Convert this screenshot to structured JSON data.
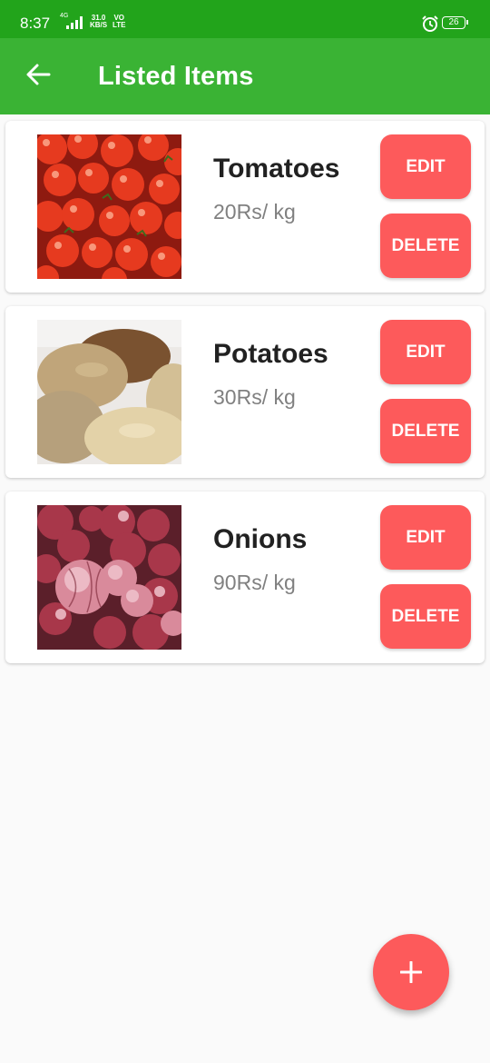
{
  "status_bar": {
    "time": "8:37",
    "network_type": "4G",
    "speed_value": "31.0",
    "speed_unit": "KB/S",
    "volte_top": "VO",
    "volte_bottom": "LTE",
    "battery": "26",
    "icons": [
      "signal-icon",
      "alarm-icon",
      "battery-icon"
    ]
  },
  "toolbar": {
    "back_icon": "arrow-left-icon",
    "title": "Listed Items",
    "background": "#3ab334"
  },
  "items": [
    {
      "name": "Tomatoes",
      "price": "20Rs/ kg",
      "edit_label": "EDIT",
      "delete_label": "DELETE",
      "image": "tomatoes-image"
    },
    {
      "name": "Potatoes",
      "price": "30Rs/ kg",
      "edit_label": "EDIT",
      "delete_label": "DELETE",
      "image": "potatoes-image"
    },
    {
      "name": "Onions",
      "price": "90Rs/ kg",
      "edit_label": "EDIT",
      "delete_label": "DELETE",
      "image": "onions-image"
    }
  ],
  "fab": {
    "icon": "plus-icon"
  },
  "colors": {
    "status_bar": "#22a41b",
    "accent_button": "#fd5a5b",
    "background": "#fafafa"
  }
}
